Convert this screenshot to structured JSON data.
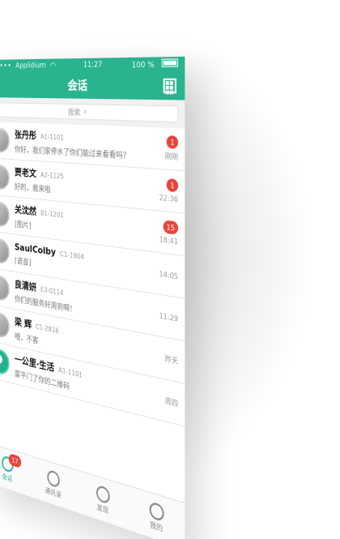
{
  "status_bar": {
    "carrier": "Applidium",
    "time": "11:27",
    "battery": "100 %"
  },
  "nav": {
    "title": "会话",
    "qr_icon": "qr-code-icon"
  },
  "search": {
    "placeholder": "搜索",
    "icon": "search-icon"
  },
  "chats": [
    {
      "name": "张丹彤",
      "code": "A1-1101",
      "message": "你好，我们家停水了你们能过来看看吗？",
      "time": "刚刚",
      "badge": "1"
    },
    {
      "name": "贾老文",
      "code": "A2-1125",
      "message": "好的，我来啦",
      "time": "22:36",
      "badge": "1"
    },
    {
      "name": "关沈然",
      "code": "B1-1201",
      "message": "[图片]",
      "time": "18:41",
      "badge": "15"
    },
    {
      "name": "SaulColby",
      "code": "C1-1904",
      "message": "[语音]",
      "time": "14:05",
      "badge": ""
    },
    {
      "name": "良清妍",
      "code": "E3-0114",
      "message": "你们的服务好周到啊！",
      "time": "11:29",
      "badge": ""
    },
    {
      "name": "梁 辉",
      "code": "C1-2816",
      "message": "哦，不客",
      "time": "昨天",
      "badge": ""
    },
    {
      "name": "一公里·生活",
      "code": "A1-1101",
      "message": "富平门了你的二维码",
      "time": "周四",
      "badge": ""
    }
  ],
  "tabbar": {
    "items": [
      {
        "label": "会话",
        "icon": "chat-icon",
        "badge": "17",
        "active": true
      },
      {
        "label": "通讯录",
        "icon": "contacts-icon",
        "badge": "",
        "active": false
      },
      {
        "label": "发现",
        "icon": "compass-icon",
        "badge": "",
        "active": false
      },
      {
        "label": "我的",
        "icon": "profile-icon",
        "badge": "",
        "active": false
      }
    ]
  }
}
